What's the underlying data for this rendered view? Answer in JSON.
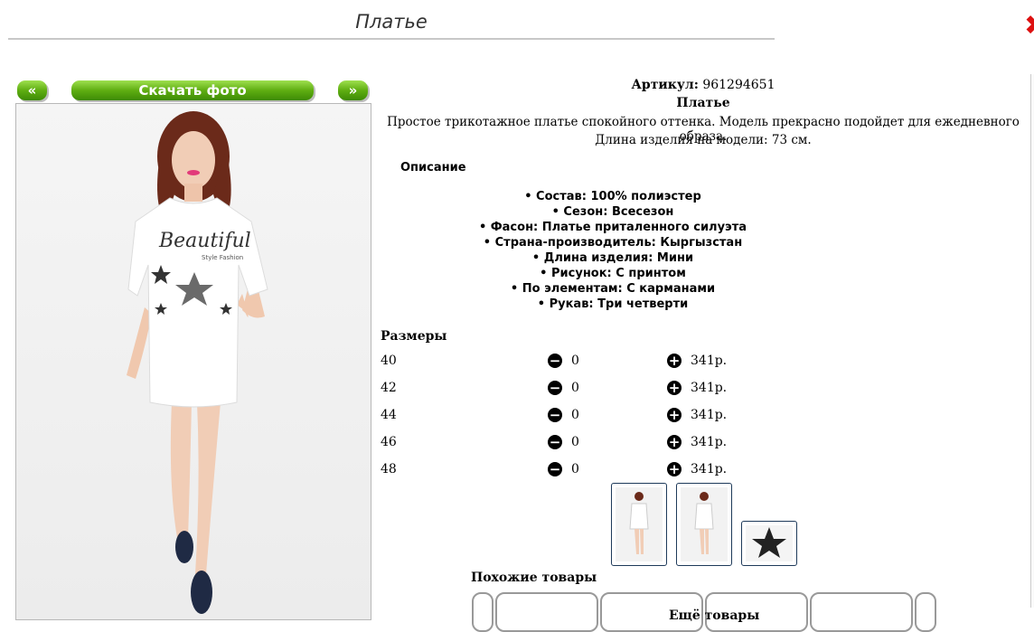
{
  "page": {
    "title": "Платье"
  },
  "nav": {
    "prev_label": "«",
    "download_label": "Скачать фото",
    "next_label": "»"
  },
  "product": {
    "article_label": "Артикул:",
    "article_value": "961294651",
    "name": "Платье",
    "summary_line1": "Простое трикотажное платье спокойного оттенка. Модель прекрасно подойдет для ежедневного образа.",
    "summary_line2": "Длина изделия на модели: 73 см.",
    "print_text": "Beautiful",
    "print_subtext": "Style Fashion"
  },
  "description": {
    "heading": "Описание",
    "properties": [
      "• Состав: 100% полиэстер",
      "• Сезон: Всесезон",
      "• Фасон: Платье приталенного силуэта",
      "• Страна-производитель: Кыргызстан",
      "• Длина изделия: Мини",
      "• Рисунок: С принтом",
      "• По элементам: С карманами",
      "• Рукав: Три четверти"
    ]
  },
  "sizes": {
    "heading": "Размеры",
    "rows": [
      {
        "size": "40",
        "qty": "0",
        "price": "341р."
      },
      {
        "size": "42",
        "qty": "0",
        "price": "341р."
      },
      {
        "size": "44",
        "qty": "0",
        "price": "341р."
      },
      {
        "size": "46",
        "qty": "0",
        "price": "341р."
      },
      {
        "size": "48",
        "qty": "0",
        "price": "341р."
      }
    ],
    "minus_icon": "minus-circle-icon",
    "plus_icon": "plus-circle-icon"
  },
  "related": {
    "similar_heading": "Похожие товары",
    "more_heading": "Ещё товары"
  },
  "colors": {
    "accent_green": "#5fae12",
    "thumb_border": "#1e3a5a",
    "close_red": "#dd1111"
  }
}
